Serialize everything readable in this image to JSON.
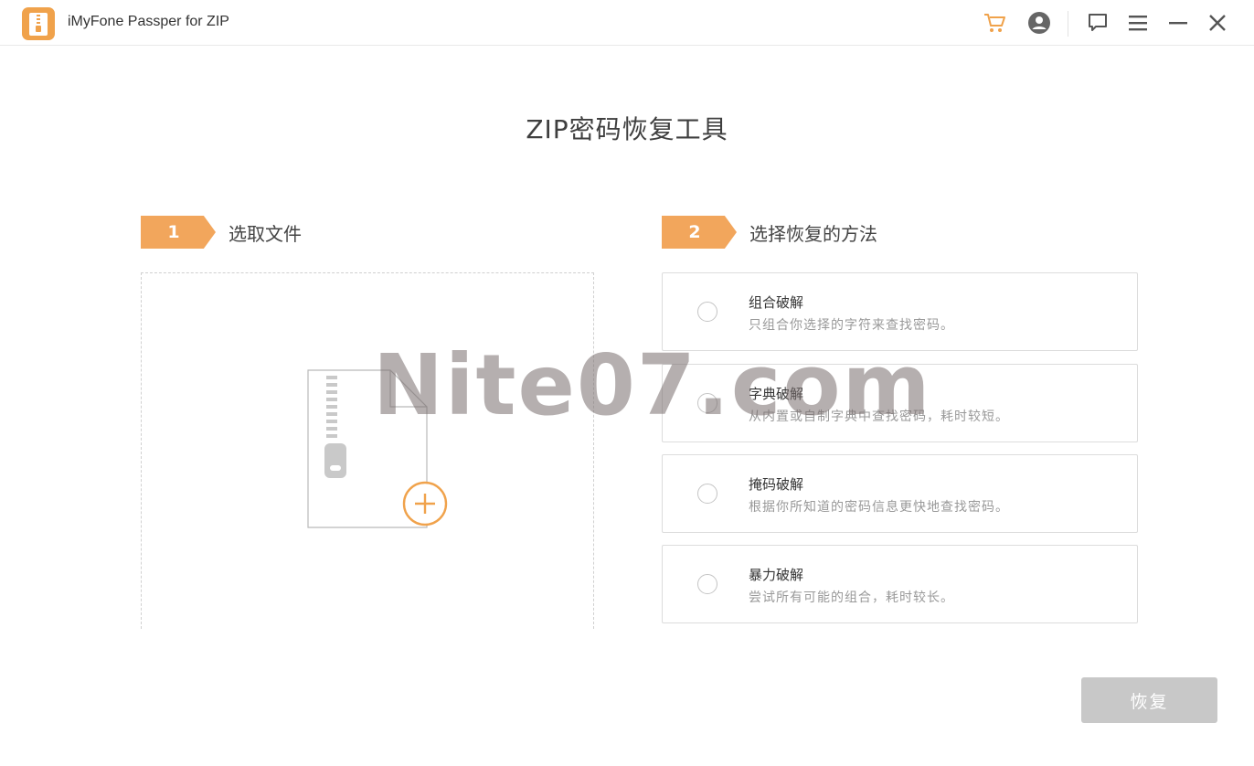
{
  "app": {
    "title": "iMyFone Passper for ZIP",
    "icon": "zip-file-icon"
  },
  "titlebar": {
    "icons": [
      "cart-icon",
      "account-icon",
      "feedback-icon",
      "menu-icon",
      "minimize-icon",
      "close-icon"
    ]
  },
  "page": {
    "title": "ZIP密码恢复工具"
  },
  "steps": [
    {
      "number": "1",
      "label": "选取文件"
    },
    {
      "number": "2",
      "label": "选择恢复的方法"
    }
  ],
  "methods": [
    {
      "title": "组合破解",
      "desc": "只组合你选择的字符来查找密码。"
    },
    {
      "title": "字典破解",
      "desc": "从内置或自制字典中查找密码，耗时较短。"
    },
    {
      "title": "掩码破解",
      "desc": "根据你所知道的密码信息更快地查找密码。"
    },
    {
      "title": "暴力破解",
      "desc": "尝试所有可能的组合，耗时较长。"
    }
  ],
  "actions": {
    "recover_label": "恢复"
  },
  "watermark": "Nite07.com",
  "colors": {
    "accent": "#f2a65c",
    "disabled_button": "#c8c8c8"
  }
}
